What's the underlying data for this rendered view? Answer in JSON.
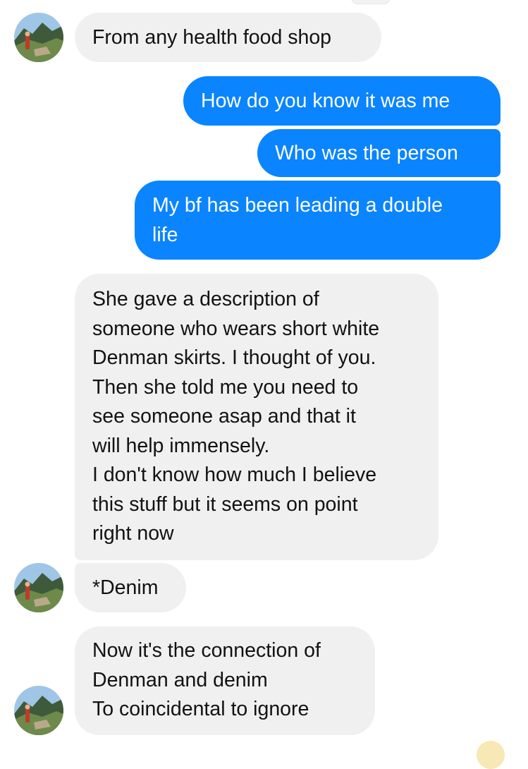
{
  "conversation": {
    "messages": [
      {
        "sender": "contact",
        "text": "From any health food shop"
      },
      {
        "sender": "me",
        "text": "How do you know it was me"
      },
      {
        "sender": "me",
        "text": "Who was the person"
      },
      {
        "sender": "me",
        "text": "My bf has been leading a double\nlife"
      },
      {
        "sender": "contact",
        "text": "She gave a description of\nsomeone who wears short white\nDenman skirts. I thought of you.\nThen she told me you need to\nsee someone asap and that it\nwill help immensely.\nI don't know how much I believe\nthis stuff but it seems on point\nright now"
      },
      {
        "sender": "contact",
        "text": "*Denim"
      },
      {
        "sender": "contact",
        "text": "Now it's the connection of\nDenman and denim\nTo coincidental to ignore"
      }
    ]
  },
  "contact": {
    "avatar_icon": "profile-photo-landscape-icon"
  },
  "colors": {
    "outgoing_bubble": "#0a84ff",
    "incoming_bubble": "#f0f0f0",
    "outgoing_text": "#ffffff",
    "incoming_text": "#121212"
  }
}
